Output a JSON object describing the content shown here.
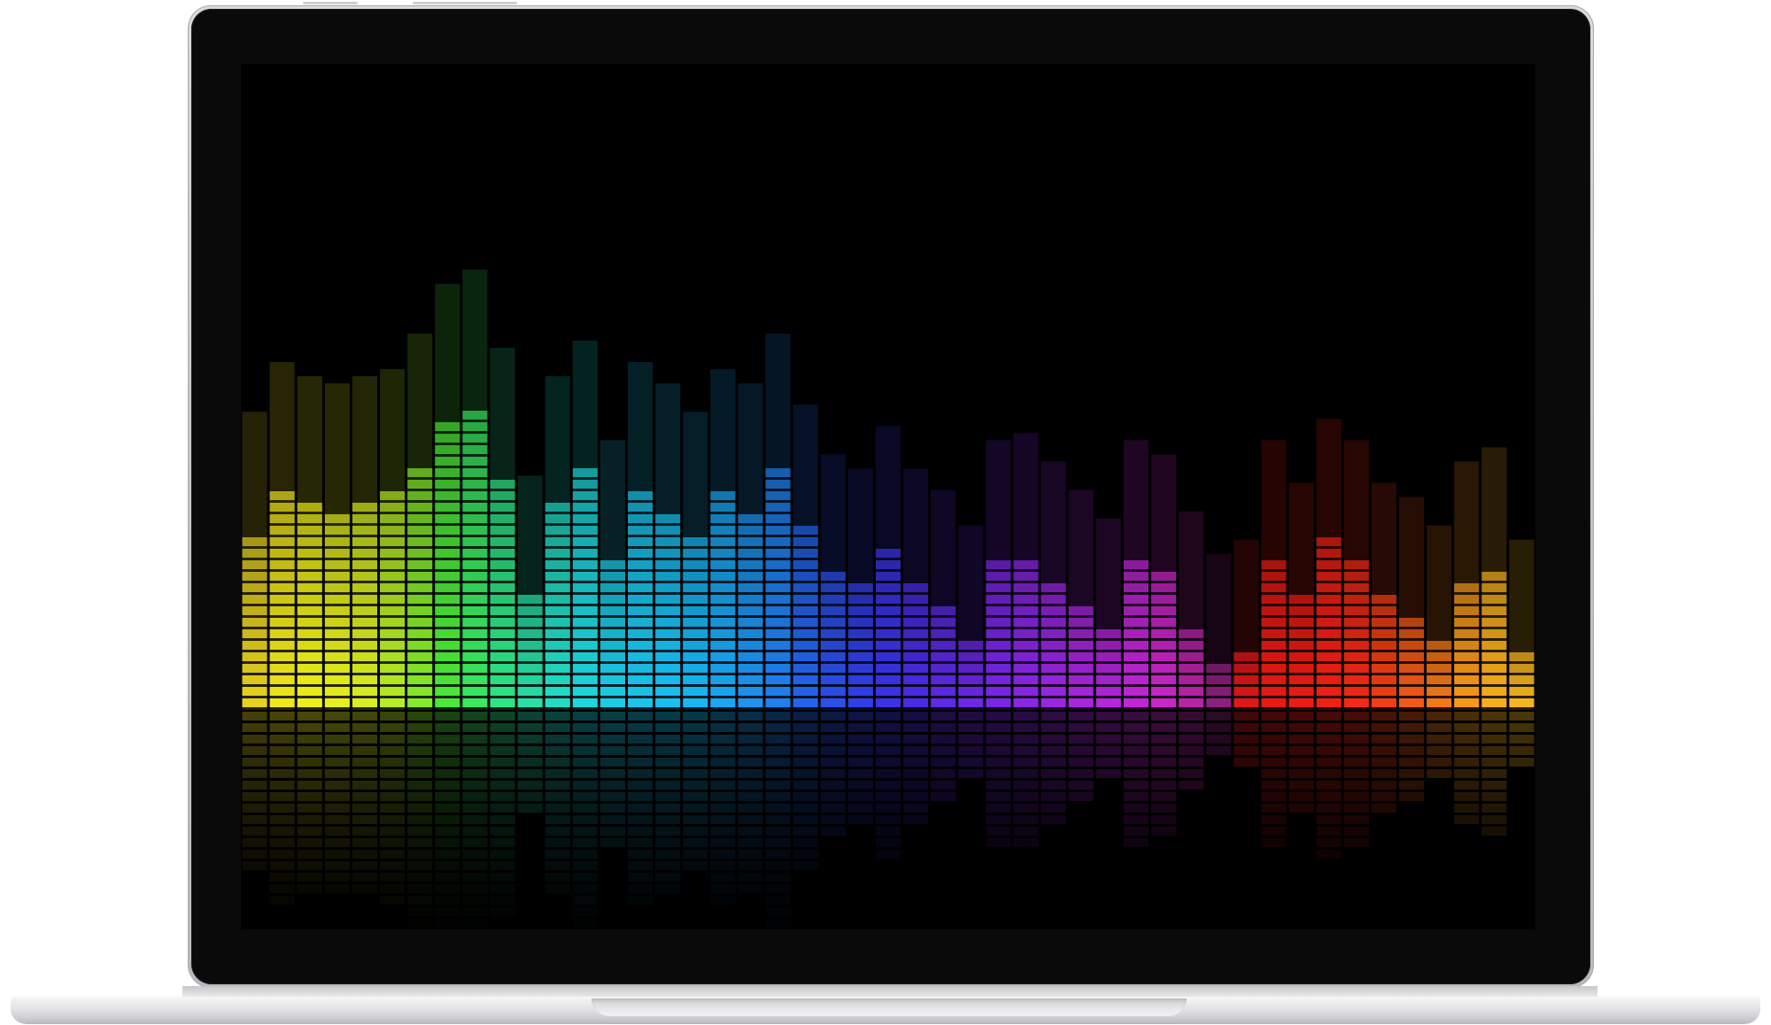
{
  "device": {
    "type": "laptop",
    "bezel_color": "#0a0a0a",
    "body_color": "#d4d4d7"
  },
  "wallpaper": {
    "subject": "audio-equalizer",
    "background_color": "#000000",
    "bars": [
      {
        "level": 0.27,
        "color": "#e6d21e"
      },
      {
        "level": 0.34,
        "color": "#f0e61c"
      },
      {
        "level": 0.32,
        "color": "#eef01a"
      },
      {
        "level": 0.31,
        "color": "#e6f01c"
      },
      {
        "level": 0.32,
        "color": "#d8ee20"
      },
      {
        "level": 0.33,
        "color": "#b8ec24"
      },
      {
        "level": 0.38,
        "color": "#86ea2a"
      },
      {
        "level": 0.45,
        "color": "#4ce838"
      },
      {
        "level": 0.47,
        "color": "#3ae860"
      },
      {
        "level": 0.36,
        "color": "#2ee486"
      },
      {
        "level": 0.18,
        "color": "#28e0a8"
      },
      {
        "level": 0.32,
        "color": "#22dcc6"
      },
      {
        "level": 0.37,
        "color": "#1ed6dc"
      },
      {
        "level": 0.23,
        "color": "#1ccde8"
      },
      {
        "level": 0.34,
        "color": "#1ac4ee"
      },
      {
        "level": 0.31,
        "color": "#18c0f2"
      },
      {
        "level": 0.27,
        "color": "#18b6f4"
      },
      {
        "level": 0.33,
        "color": "#1aa6f2"
      },
      {
        "level": 0.31,
        "color": "#1c94f0"
      },
      {
        "level": 0.38,
        "color": "#2080ee"
      },
      {
        "level": 0.28,
        "color": "#2464ec"
      },
      {
        "level": 0.21,
        "color": "#2a50ea"
      },
      {
        "level": 0.19,
        "color": "#3040e8"
      },
      {
        "level": 0.25,
        "color": "#3a34e6"
      },
      {
        "level": 0.19,
        "color": "#4a2ce6"
      },
      {
        "level": 0.16,
        "color": "#5e2ae6"
      },
      {
        "level": 0.11,
        "color": "#6c28e6"
      },
      {
        "level": 0.23,
        "color": "#7a26e6"
      },
      {
        "level": 0.24,
        "color": "#8a26e6"
      },
      {
        "level": 0.2,
        "color": "#9a26e4"
      },
      {
        "level": 0.16,
        "color": "#a826e0"
      },
      {
        "level": 0.12,
        "color": "#b426dc"
      },
      {
        "level": 0.23,
        "color": "#c026d6"
      },
      {
        "level": 0.21,
        "color": "#c826c8"
      },
      {
        "level": 0.13,
        "color": "#b824a8"
      },
      {
        "level": 0.07,
        "color": "#8c2080"
      },
      {
        "level": 0.09,
        "color": "#e01818"
      },
      {
        "level": 0.23,
        "color": "#e81a14"
      },
      {
        "level": 0.17,
        "color": "#ec1c14"
      },
      {
        "level": 0.26,
        "color": "#f02014"
      },
      {
        "level": 0.23,
        "color": "#f02a14"
      },
      {
        "level": 0.17,
        "color": "#f03e14"
      },
      {
        "level": 0.15,
        "color": "#f25a16"
      },
      {
        "level": 0.11,
        "color": "#f47818"
      },
      {
        "level": 0.2,
        "color": "#f6981a"
      },
      {
        "level": 0.22,
        "color": "#f8ae1c"
      },
      {
        "level": 0.09,
        "color": "#f6b41e"
      }
    ]
  }
}
